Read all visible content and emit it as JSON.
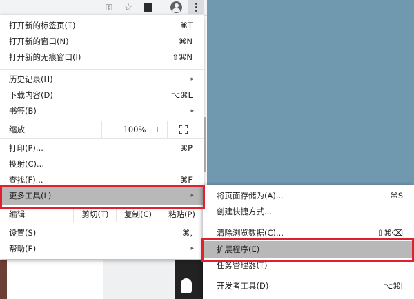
{
  "menu": {
    "items": [
      {
        "label": "打开新的标签页(T)",
        "shortcut": "⌘T"
      },
      {
        "label": "打开新的窗口(N)",
        "shortcut": "⌘N"
      },
      {
        "label": "打开新的无痕窗口(I)",
        "shortcut": "⇧⌘N"
      },
      {
        "label": "历史记录(H)",
        "arrow": "▸"
      },
      {
        "label": "下载内容(D)",
        "shortcut": "⌥⌘L"
      },
      {
        "label": "书签(B)",
        "arrow": "▸"
      },
      {
        "label": "打印(P)...",
        "shortcut": "⌘P"
      },
      {
        "label": "投射(C)..."
      },
      {
        "label": "查找(F)...",
        "shortcut": "⌘F"
      },
      {
        "label": "更多工具(L)",
        "arrow": "▸"
      },
      {
        "label": "设置(S)",
        "shortcut": "⌘,"
      },
      {
        "label": "帮助(E)",
        "arrow": "▸"
      }
    ],
    "zoom": {
      "label": "缩放",
      "minus": "−",
      "value": "100%",
      "plus": "+"
    },
    "edit": {
      "label": "编辑",
      "cut": "剪切(T)",
      "copy": "复制(C)",
      "paste": "粘贴(P)"
    }
  },
  "submenu": {
    "items": [
      {
        "label": "将页面存储为(A)...",
        "shortcut": "⌘S"
      },
      {
        "label": "创建快捷方式..."
      },
      {
        "label": "清除浏览数据(C)...",
        "shortcut": "⇧⌘⌫"
      },
      {
        "label": "扩展程序(E)"
      },
      {
        "label": "任务管理器(T)"
      },
      {
        "label": "开发者工具(D)",
        "shortcut": "⌥⌘I"
      }
    ]
  },
  "toolbar": {
    "key_icon": "⚿",
    "star_icon": "☆"
  },
  "colors": {
    "desktop": "#7099b0",
    "highlight": "#b8b8b8",
    "annotation_red": "#e0202e"
  }
}
